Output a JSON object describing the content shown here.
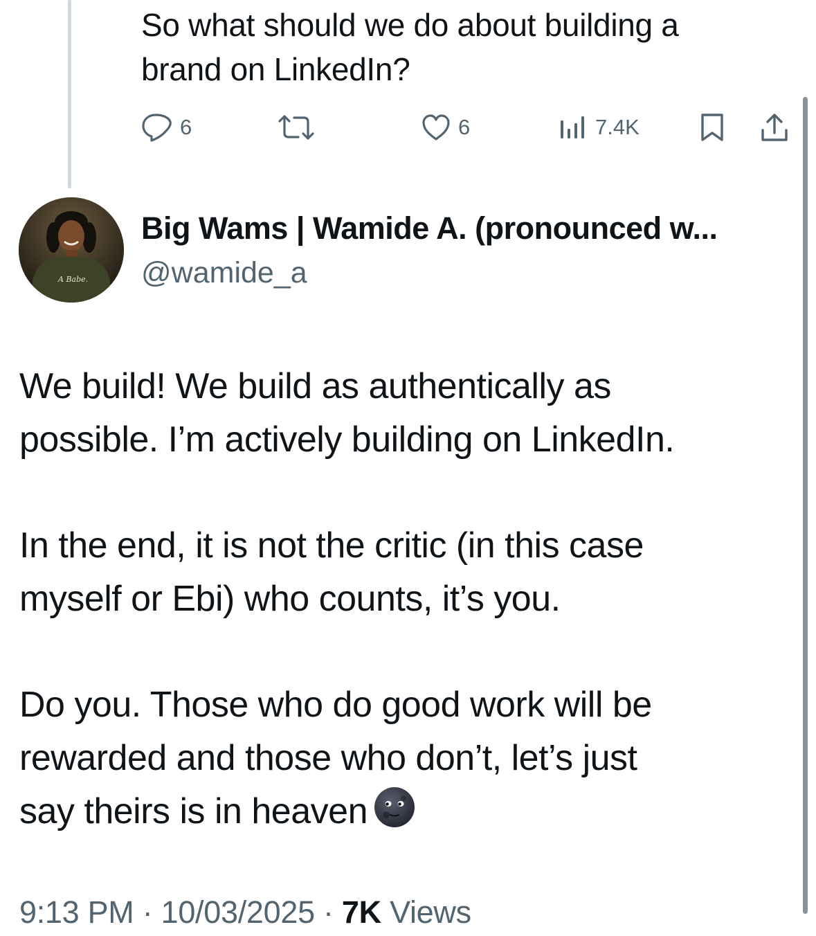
{
  "parent_tweet": {
    "text": "So what should we do about building a\nbrand on LinkedIn?",
    "actions": {
      "replies": "6",
      "likes": "6",
      "views": "7.4K"
    }
  },
  "tweet": {
    "author": {
      "display_name": "Big Wams | Wamide A. (pronounced w...",
      "handle": "@wamide_a",
      "avatar_shirt_text": "A Babe."
    },
    "paragraphs": [
      "We build! We build as authentically as\npossible. I’m actively building on LinkedIn.",
      "In the end, it is not the critic (in this case\nmyself or Ebi) who counts, it’s you.",
      "Do you. Those who do good work will be\nrewarded and those who don’t, let’s just\nsay theirs is in heaven"
    ],
    "emoji": "new-moon-face",
    "meta": {
      "time": "9:13 PM",
      "separator": "·",
      "date": "10/03/2025",
      "views_count": "7K",
      "views_label": "Views"
    }
  },
  "colors": {
    "text_primary": "#0f1419",
    "text_secondary": "#536471",
    "thread_line": "#cfd9de"
  }
}
